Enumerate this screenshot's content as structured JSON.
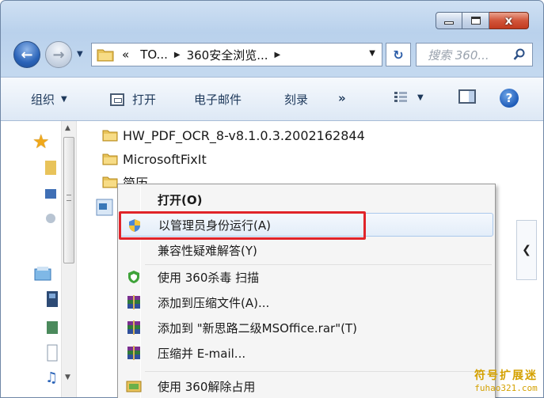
{
  "window": {
    "caption_min": "minimize",
    "caption_max": "maximize",
    "caption_close": "x"
  },
  "nav": {
    "back_icon": "back-arrow",
    "forward_icon": "forward-arrow",
    "breadcrumb_overflow": "«",
    "breadcrumbs": [
      "TO...",
      "360安全浏览..."
    ],
    "search_placeholder": "搜索 360..."
  },
  "toolbar": {
    "organize": "组织",
    "open": "打开",
    "email": "电子邮件",
    "burn": "刻录",
    "more": "»"
  },
  "files": [
    {
      "name": "HW_PDF_OCR_8-v8.1.0.3.2002162844"
    },
    {
      "name": "MicrosoftFixIt"
    },
    {
      "name": "简历"
    }
  ],
  "context_menu": {
    "items": [
      {
        "label": "打开(O)",
        "icon": "none",
        "bold": true
      },
      {
        "label": "以管理员身份运行(A)",
        "icon": "uac-shield-icon",
        "hover": true
      },
      {
        "label": "兼容性疑难解答(Y)",
        "icon": "none"
      },
      {
        "label": "使用 360杀毒 扫描",
        "icon": "360-shield-icon"
      },
      {
        "label": "添加到压缩文件(A)...",
        "icon": "winrar-icon"
      },
      {
        "label": "添加到 \"新思路二级MSOffice.rar\"(T)",
        "icon": "winrar-icon"
      },
      {
        "label": "压缩并 E-mail...",
        "icon": "winrar-icon"
      },
      {
        "label": "使用 360解除占用",
        "icon": "360-unlock-icon"
      }
    ]
  },
  "watermark": {
    "line1": "符号扩展迷",
    "line2": "fuhao321.com"
  },
  "colors": {
    "highlight": "#e0242a",
    "accent": "#2a63b8"
  }
}
